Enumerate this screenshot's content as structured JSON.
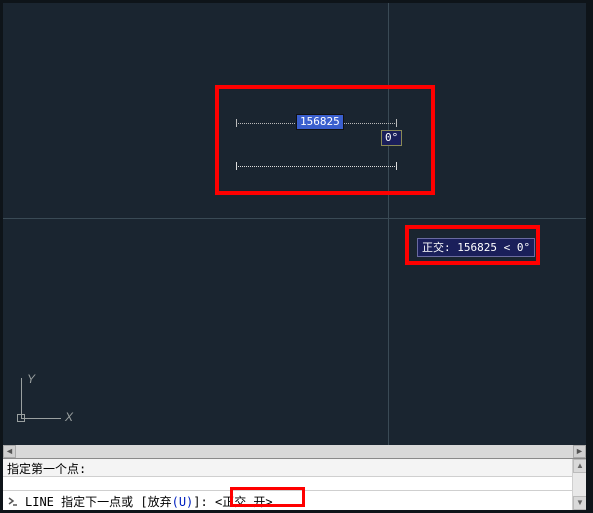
{
  "drawing": {
    "dynamic_input": {
      "length_value": "156825",
      "angle_value": "0°"
    },
    "ortho_tooltip": "正交: 156825 < 0°",
    "ucs": {
      "x_label": "X",
      "y_label": "Y"
    }
  },
  "command": {
    "history_line": "指定第一个点:",
    "prompt_command": "LINE",
    "prompt_text_pre": " 指定下一点或 [",
    "prompt_option_label": "放弃",
    "prompt_option_key": "(U)",
    "prompt_text_post": "]: ",
    "event_text": "<正交 开>"
  },
  "highlights": {
    "box1": "dynamic-input-highlight",
    "box2": "ortho-tooltip-highlight",
    "box3": "ortho-event-highlight"
  }
}
